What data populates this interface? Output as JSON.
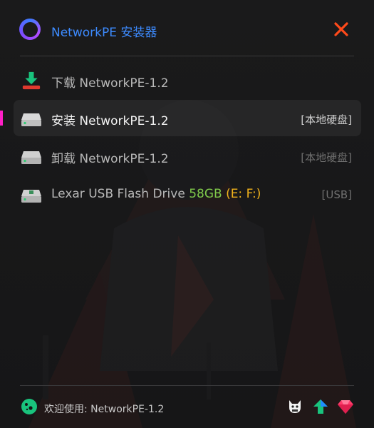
{
  "app": {
    "title": "NetworkPE 安装器"
  },
  "menu": [
    {
      "label": "下载 NetworkPE-1.2",
      "tag": "",
      "icon": "download-icon"
    },
    {
      "label": "安装 NetworkPE-1.2",
      "tag": "[本地硬盘]",
      "icon": "hard-drive-icon"
    },
    {
      "label": "卸载 NetworkPE-1.2",
      "tag": "[本地硬盘]",
      "icon": "hard-drive-icon"
    },
    {
      "label": "Lexar USB Flash Drive",
      "size": "58GB",
      "drives": "(E: F:)",
      "tag": "[USB]",
      "icon": "usb-drive-icon"
    }
  ],
  "footer": {
    "welcome": "欢迎使用: NetworkPE-1.2"
  },
  "colors": {
    "accent": "#3d8bff",
    "close": "#ff4a1a",
    "marker": "#ff1fc6",
    "size_green": "#7fc84a",
    "drive_yellow": "#f0b21b"
  }
}
